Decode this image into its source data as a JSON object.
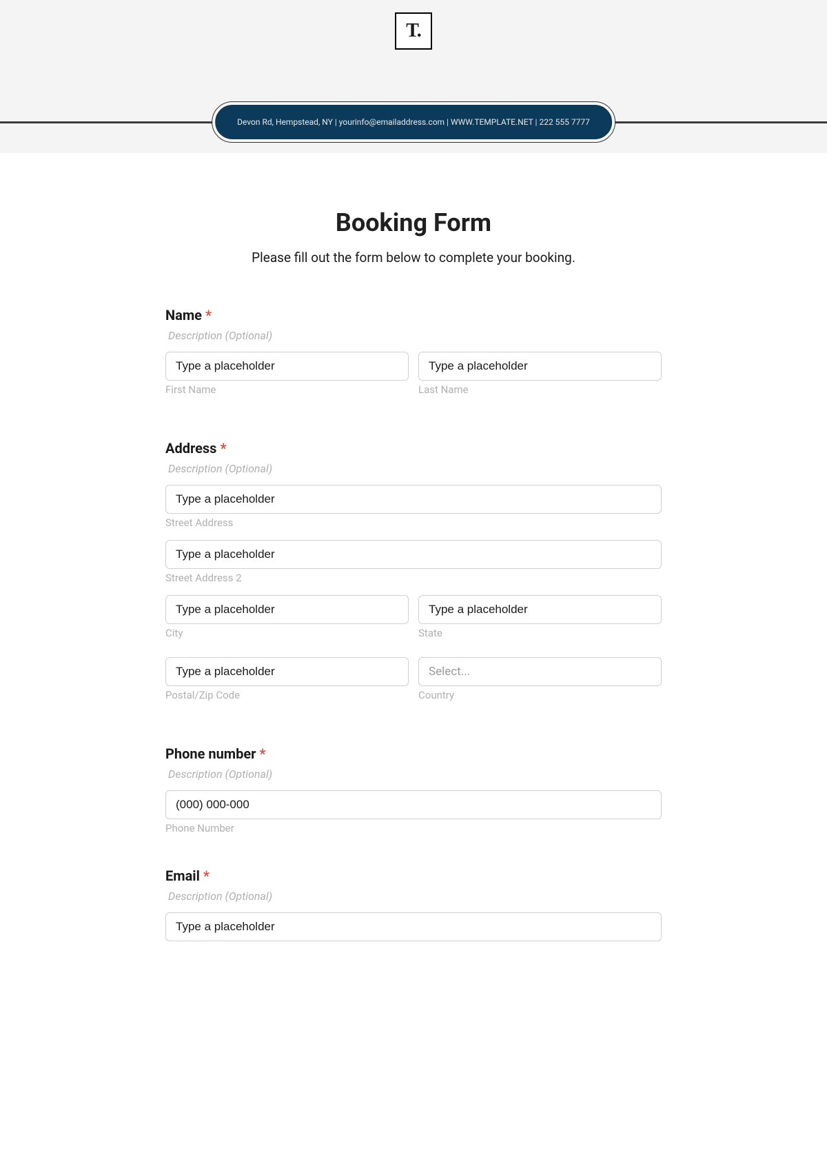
{
  "header": {
    "logo_text": "T.",
    "pill_text": "Devon Rd, Hempstead, NY | yourinfo@emailaddress.com | WWW.TEMPLATE.NET | 222 555 7777"
  },
  "form": {
    "title": "Booking Form",
    "subtitle": "Please fill out the form below to complete your booking."
  },
  "name_section": {
    "label": "Name",
    "required_mark": "*",
    "description": "Description (Optional)",
    "first_name_placeholder": "Type a placeholder",
    "first_name_sublabel": "First Name",
    "last_name_placeholder": "Type a placeholder",
    "last_name_sublabel": "Last Name"
  },
  "address_section": {
    "label": "Address",
    "required_mark": "*",
    "description": "Description (Optional)",
    "street_placeholder": "Type a placeholder",
    "street_sublabel": "Street Address",
    "street2_placeholder": "Type a placeholder",
    "street2_sublabel": "Street Address 2",
    "city_placeholder": "Type a placeholder",
    "city_sublabel": "City",
    "state_placeholder": "Type a placeholder",
    "state_sublabel": "State",
    "postal_placeholder": "Type a placeholder",
    "postal_sublabel": "Postal/Zip Code",
    "country_placeholder": "Select...",
    "country_sublabel": "Country"
  },
  "phone_section": {
    "label": "Phone number",
    "required_mark": "*",
    "description": "Description (Optional)",
    "phone_placeholder": "(000) 000-000",
    "phone_sublabel": "Phone Number"
  },
  "email_section": {
    "label": "Email",
    "required_mark": "*",
    "description": "Description (Optional)",
    "email_placeholder": "Type a placeholder"
  }
}
